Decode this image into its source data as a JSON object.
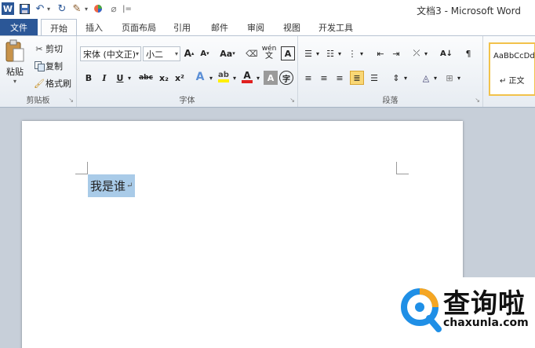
{
  "window": {
    "title": "文档3 - Microsoft Word"
  },
  "quick_access": {
    "word_icon": "W",
    "separator": "|="
  },
  "tabs": [
    "文件",
    "开始",
    "插入",
    "页面布局",
    "引用",
    "邮件",
    "审阅",
    "视图",
    "开发工具"
  ],
  "active_tab": "开始",
  "ribbon": {
    "clipboard": {
      "label": "剪贴板",
      "paste": "粘贴",
      "cut": "剪切",
      "copy": "复制",
      "format_painter": "格式刷"
    },
    "font": {
      "label": "字体",
      "font_name": "宋体 (中文正)",
      "font_size": "小二",
      "grow": "A",
      "shrink": "A",
      "change_case": "Aa",
      "bold": "B",
      "italic": "I",
      "underline": "U",
      "strikethrough": "abc",
      "subscript": "x₂",
      "superscript": "x²",
      "char_border": "A",
      "phonetic": "wén",
      "enclose": "字"
    },
    "paragraph": {
      "label": "段落"
    },
    "styles": {
      "sample": "AaBbCcDd",
      "normal": "↵ 正文"
    }
  },
  "document": {
    "text": "我是谁",
    "paragraph_mark": "↵"
  },
  "watermark": {
    "brand": "查询啦",
    "url": "chaxunla.com"
  },
  "colors": {
    "file_tab": "#2b5797",
    "selection": "#a9cbe8",
    "highlight_button": "#f9d775"
  }
}
